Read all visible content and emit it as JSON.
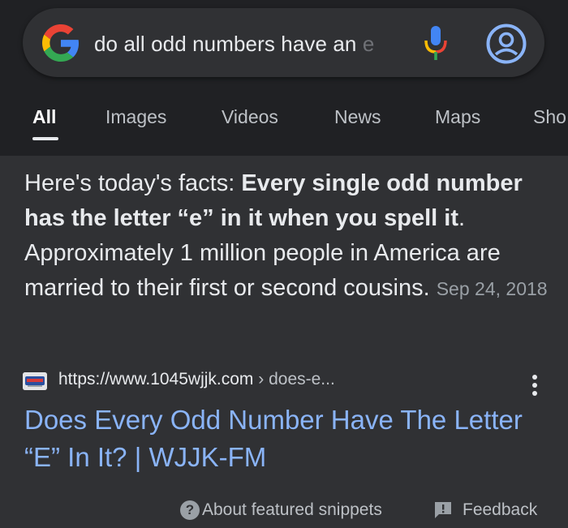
{
  "search": {
    "query_visible": "do all odd numbers have an",
    "query_faded": " e"
  },
  "tabs": [
    {
      "label": "All"
    },
    {
      "label": "Images"
    },
    {
      "label": "Videos"
    },
    {
      "label": "News"
    },
    {
      "label": "Maps"
    },
    {
      "label": "Sho"
    }
  ],
  "snippet": {
    "intro": "Here's today's facts: ",
    "bold": "Every single odd number has the letter “e” in it when you spell it",
    "rest": ". Approximately 1 million people in America are married to their first or second cousins.",
    "date": "Sep 24, 2018"
  },
  "result": {
    "url": "https://www.1045wjjk.com",
    "breadcrumb": " › does-e...",
    "title": "Does Every Odd Number Have The Letter “E” In It? | WJJK-FM"
  },
  "footer": {
    "about_label": "About featured snippets",
    "about_icon": "?",
    "feedback_label": "Feedback"
  },
  "colors": {
    "background": "#303134",
    "header": "#202124",
    "link": "#8ab4f8",
    "google_blue": "#4285F4",
    "google_red": "#EA4335",
    "google_yellow": "#FBBC05",
    "google_green": "#34A853"
  },
  "icons": {
    "logo": "google-g-icon",
    "mic": "microphone-icon",
    "account": "account-icon",
    "menu": "more-vert-icon",
    "help": "help-circle-icon",
    "feedback": "feedback-icon"
  }
}
